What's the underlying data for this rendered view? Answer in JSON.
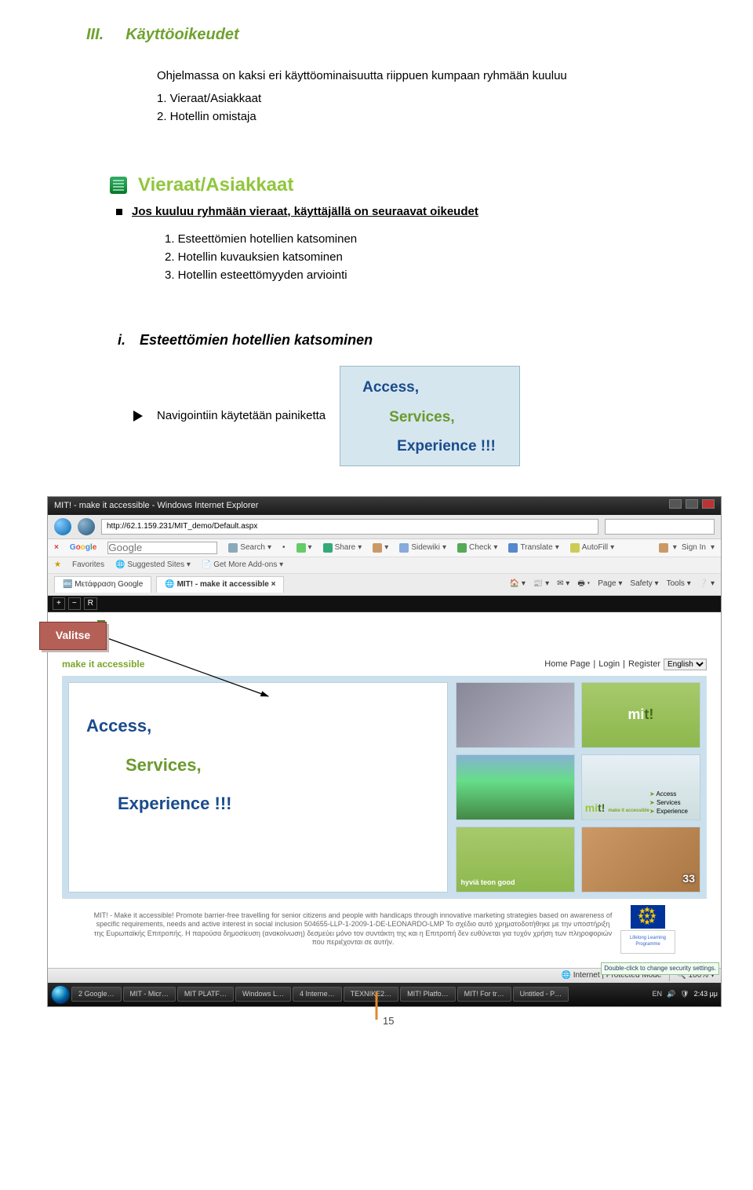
{
  "heading": {
    "num": "III.",
    "text": "Käyttöoikeudet"
  },
  "intro": "Ohjelmassa on kaksi eri käyttöominaisuutta riippuen kumpaan ryhmään kuuluu",
  "roles": [
    "1. Vieraat/Asiakkaat",
    "2. Hotellin omistaja"
  ],
  "section2": {
    "title": "Vieraat/Asiakkaat",
    "bullet": "Jos kuuluu ryhmään vieraat, käyttäjällä on seuraavat oikeudet",
    "items": [
      "1. Esteettömien hotellien katsominen",
      "2. Hotellin kuvauksien katsominen",
      "3. Hotellin esteettömyyden arviointi"
    ]
  },
  "sub_i": {
    "num": "i.",
    "text": "Esteettömien hotellien katsominen"
  },
  "nav_text": "Navigointiin käytetään painiketta",
  "access_box": {
    "a1": "Access,",
    "a2": "Services,",
    "a3": "Experience !!!"
  },
  "callout": {
    "label": "Valitse"
  },
  "browser": {
    "title": "MIT! - make it accessible - Windows Internet Explorer",
    "url": "http://62.1.159.231/MIT_demo/Default.aspx",
    "google_search_placeholder": "Google",
    "toolbar": {
      "google": "Google",
      "search": "Search",
      "share": "Share",
      "sidewiki": "Sidewiki",
      "check": "Check",
      "translate": "Translate",
      "autofill": "AutoFill",
      "signin": "Sign In"
    },
    "favbar": {
      "favorites": "Favorites",
      "suggested": "Suggested Sites",
      "addons": "Get More Add-ons"
    },
    "tabs": {
      "tab1": "Μετάφραση Google",
      "tab2": "MIT! - make it accessible",
      "menu": {
        "page": "Page",
        "safety": "Safety",
        "tools": "Tools"
      }
    },
    "a11y": {
      "plus": "+",
      "minus": "−",
      "r": "R"
    },
    "content": {
      "logo_tag": "make it accessible",
      "toplinks": {
        "home": "Home Page",
        "login": "Login",
        "register": "Register",
        "lang": "English"
      },
      "left": {
        "a1": "Access,",
        "a2": "Services,",
        "a3": "Experience !!!"
      },
      "thumbs": {
        "t2_logo": "mit!",
        "t4_items": [
          "Access",
          "Services",
          "Experience"
        ],
        "t5_words": "hyviä\nteon\ngood",
        "t6_number": "33"
      },
      "footer": "MIT! - Make it accessible! Promote barrier-free travelling for senior citizens and people with handicaps through innovative marketing strategies based on awareness of specific requirements, needs and active interest in social inclusion 504655-LLP-1-2009-1-DE-LEONARDO-LMP Το σχέδιο αυτό χρηματοδοτήθηκε με την υποστήριξη της Ευρωπαϊκής Επιτροπής. Η παρούσα δημοσίευση (ανακοίνωση) δεσμεύει μόνο τον συντάκτη της και η Επιτροπή δεν ευθύνεται για τυχόν χρήση των πληροφοριών που περιέχονται σε αυτήν.",
      "llp": "Lifelong Learning Programme"
    },
    "statusbar": {
      "dblclick": "Double-click to change security settings.",
      "internet": "Internet | Protected Mode",
      "zoom": "100%"
    },
    "taskbar": {
      "items": [
        "2 Google…",
        "MIT - Micr…",
        "MIT PLATF…",
        "Windows L…",
        "4 Interne…",
        "TEXNIKE2…",
        "MIT! Platfo…",
        "MIT! For tr…",
        "Untitled - P…"
      ],
      "lang": "EN",
      "time": "2:43 μμ"
    }
  },
  "page_number": "15"
}
